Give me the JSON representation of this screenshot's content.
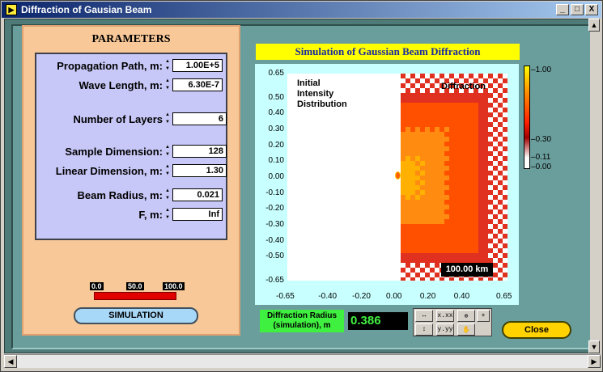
{
  "window": {
    "title": "Diffraction of Gausian Beam",
    "app_icon": "labview-icon",
    "buttons": {
      "minimize": "_",
      "maximize": "□",
      "close": "X"
    }
  },
  "parameters": {
    "title": "PARAMETERS",
    "fields": [
      {
        "label": "Propagation Path, m:",
        "value": "1.00E+5"
      },
      {
        "label": "Wave Length, m:",
        "value": "6.30E-7"
      },
      {
        "label": "Number of Layers",
        "value": "6"
      },
      {
        "label": "Sample Dimension:",
        "value": "128"
      },
      {
        "label": "Linear Dimension, m:",
        "value": "1.30"
      },
      {
        "label": "Beam Radius, m:",
        "value": "0.021"
      },
      {
        "label": "F, m:",
        "value": "Inf"
      }
    ],
    "progress": {
      "min_label": "0.0",
      "mid_label": "50.0",
      "max_label": "100.0",
      "value": 100
    },
    "simulation_button": "SIMULATION"
  },
  "chart": {
    "title": "Simulation of Gaussian Beam Diffraction",
    "initial_label": "Initial\nIntensity\nDistribution",
    "diffraction_label": "Diffraction",
    "scale_label": "100.00 km",
    "colorbar": {
      "labels": [
        "1.00",
        "0.30",
        "0.11",
        "0.00"
      ]
    }
  },
  "chart_data": {
    "type": "heatmap",
    "title": "Simulation of Gaussian Beam Diffraction",
    "xlabel": "",
    "ylabel": "",
    "xlim": [
      -0.65,
      0.65
    ],
    "ylim": [
      -0.65,
      0.65
    ],
    "x_ticks": [
      "-0.65",
      "-0.40",
      "-0.20",
      "0.00",
      "0.20",
      "0.40",
      "0.65"
    ],
    "y_ticks": [
      "0.65",
      "0.50",
      "0.40",
      "0.30",
      "0.20",
      "0.10",
      "0.00",
      "-0.10",
      "-0.20",
      "-0.30",
      "-0.40",
      "-0.50",
      "-0.65"
    ],
    "colorscale": [
      "#ffffff",
      "#a00000",
      "#ff2000",
      "#ff9000",
      "#ffff00"
    ],
    "colorscale_ticks": [
      0.0,
      0.11,
      0.3,
      1.0
    ]
  },
  "diffraction_radius": {
    "label": "Diffraction Radius (simulation), m",
    "value": "0.386"
  },
  "tools": {
    "buttons": [
      "x-zoom",
      "x.xx",
      "zoom",
      "cursor",
      "y-zoom",
      "y.yy",
      "pan"
    ]
  },
  "close_button": "Close"
}
